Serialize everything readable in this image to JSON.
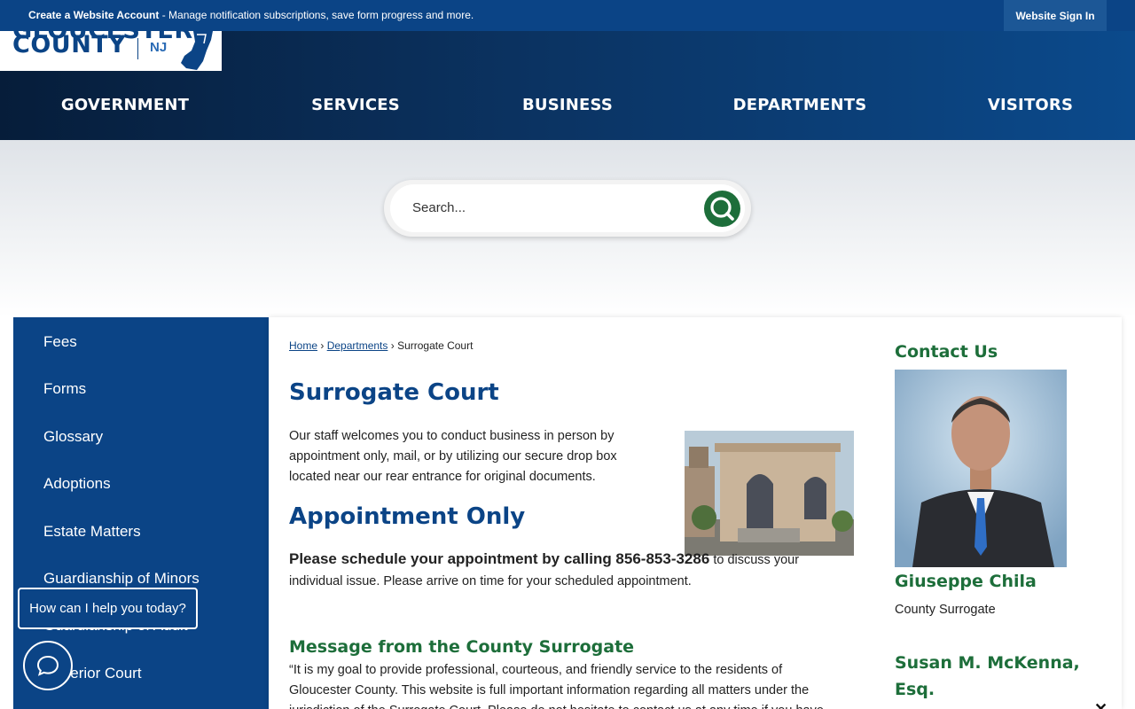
{
  "topbar": {
    "account_link": "Create a Website Account",
    "account_desc": " - Manage notification subscriptions, save form progress and more.",
    "signin": "Website Sign In"
  },
  "logo": {
    "county": "COUNTY",
    "state": "NJ"
  },
  "nav": {
    "items": [
      {
        "label": "GOVERNMENT"
      },
      {
        "label": "SERVICES"
      },
      {
        "label": "BUSINESS"
      },
      {
        "label": "DEPARTMENTS"
      },
      {
        "label": "VISITORS"
      }
    ]
  },
  "search": {
    "placeholder": "Search..."
  },
  "sidebar": {
    "items": [
      {
        "label": "Fees"
      },
      {
        "label": "Forms"
      },
      {
        "label": "Glossary"
      },
      {
        "label": "Adoptions"
      },
      {
        "label": "Estate Matters"
      },
      {
        "label": "Guardianship of Minors"
      },
      {
        "label": "Guardianship of Adult"
      },
      {
        "label": "Superior Court"
      }
    ]
  },
  "breadcrumb": {
    "home": "Home",
    "departments": "Departments",
    "current": "Surrogate Court"
  },
  "main": {
    "title": "Surrogate Court",
    "intro": "Our staff welcomes you to conduct business in person by appointment only, mail, or by utilizing our secure drop box located near our rear entrance for original documents.",
    "appointment_heading": "Appointment Only",
    "appointment_bold": "Please schedule your appointment by calling 856-853-3286",
    "appointment_rest": " to discuss your individual issue. Please arrive on time for your scheduled appointment.",
    "message_heading": "Message from the County Surrogate",
    "message_text": "“It is my goal to provide professional, courteous, and friendly service to the residents of Gloucester County. This website is full important information regarding all matters under the jurisdiction of the Surrogate Court. Please do not hesitate to contact us at any time if you have"
  },
  "contact": {
    "title": "Contact Us",
    "person1_name": "Giuseppe Chila",
    "person1_role": "County Surrogate",
    "person2_name": "Susan M. McKenna, Esq."
  },
  "chat": {
    "prompt": "How can I help you today?"
  },
  "colors": {
    "brand_blue": "#0b4486",
    "accent_green": "#1d6e3a"
  }
}
